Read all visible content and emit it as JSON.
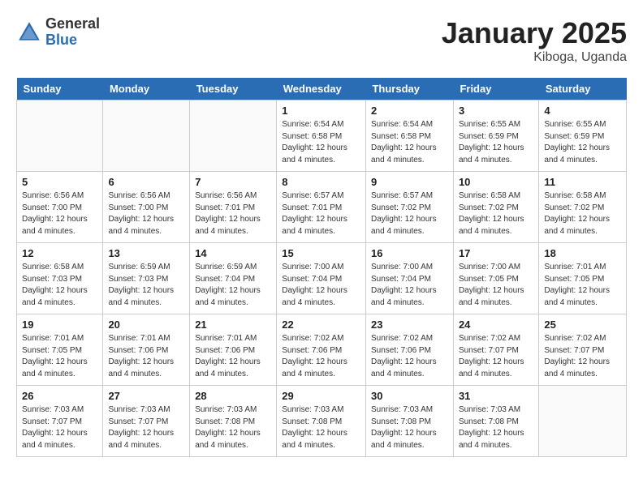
{
  "header": {
    "logo_general": "General",
    "logo_blue": "Blue",
    "month_title": "January 2025",
    "location": "Kiboga, Uganda"
  },
  "days_of_week": [
    "Sunday",
    "Monday",
    "Tuesday",
    "Wednesday",
    "Thursday",
    "Friday",
    "Saturday"
  ],
  "weeks": [
    [
      {
        "day": "",
        "info": ""
      },
      {
        "day": "",
        "info": ""
      },
      {
        "day": "",
        "info": ""
      },
      {
        "day": "1",
        "info": "Sunrise: 6:54 AM\nSunset: 6:58 PM\nDaylight: 12 hours\nand 4 minutes."
      },
      {
        "day": "2",
        "info": "Sunrise: 6:54 AM\nSunset: 6:58 PM\nDaylight: 12 hours\nand 4 minutes."
      },
      {
        "day": "3",
        "info": "Sunrise: 6:55 AM\nSunset: 6:59 PM\nDaylight: 12 hours\nand 4 minutes."
      },
      {
        "day": "4",
        "info": "Sunrise: 6:55 AM\nSunset: 6:59 PM\nDaylight: 12 hours\nand 4 minutes."
      }
    ],
    [
      {
        "day": "5",
        "info": "Sunrise: 6:56 AM\nSunset: 7:00 PM\nDaylight: 12 hours\nand 4 minutes."
      },
      {
        "day": "6",
        "info": "Sunrise: 6:56 AM\nSunset: 7:00 PM\nDaylight: 12 hours\nand 4 minutes."
      },
      {
        "day": "7",
        "info": "Sunrise: 6:56 AM\nSunset: 7:01 PM\nDaylight: 12 hours\nand 4 minutes."
      },
      {
        "day": "8",
        "info": "Sunrise: 6:57 AM\nSunset: 7:01 PM\nDaylight: 12 hours\nand 4 minutes."
      },
      {
        "day": "9",
        "info": "Sunrise: 6:57 AM\nSunset: 7:02 PM\nDaylight: 12 hours\nand 4 minutes."
      },
      {
        "day": "10",
        "info": "Sunrise: 6:58 AM\nSunset: 7:02 PM\nDaylight: 12 hours\nand 4 minutes."
      },
      {
        "day": "11",
        "info": "Sunrise: 6:58 AM\nSunset: 7:02 PM\nDaylight: 12 hours\nand 4 minutes."
      }
    ],
    [
      {
        "day": "12",
        "info": "Sunrise: 6:58 AM\nSunset: 7:03 PM\nDaylight: 12 hours\nand 4 minutes."
      },
      {
        "day": "13",
        "info": "Sunrise: 6:59 AM\nSunset: 7:03 PM\nDaylight: 12 hours\nand 4 minutes."
      },
      {
        "day": "14",
        "info": "Sunrise: 6:59 AM\nSunset: 7:04 PM\nDaylight: 12 hours\nand 4 minutes."
      },
      {
        "day": "15",
        "info": "Sunrise: 7:00 AM\nSunset: 7:04 PM\nDaylight: 12 hours\nand 4 minutes."
      },
      {
        "day": "16",
        "info": "Sunrise: 7:00 AM\nSunset: 7:04 PM\nDaylight: 12 hours\nand 4 minutes."
      },
      {
        "day": "17",
        "info": "Sunrise: 7:00 AM\nSunset: 7:05 PM\nDaylight: 12 hours\nand 4 minutes."
      },
      {
        "day": "18",
        "info": "Sunrise: 7:01 AM\nSunset: 7:05 PM\nDaylight: 12 hours\nand 4 minutes."
      }
    ],
    [
      {
        "day": "19",
        "info": "Sunrise: 7:01 AM\nSunset: 7:05 PM\nDaylight: 12 hours\nand 4 minutes."
      },
      {
        "day": "20",
        "info": "Sunrise: 7:01 AM\nSunset: 7:06 PM\nDaylight: 12 hours\nand 4 minutes."
      },
      {
        "day": "21",
        "info": "Sunrise: 7:01 AM\nSunset: 7:06 PM\nDaylight: 12 hours\nand 4 minutes."
      },
      {
        "day": "22",
        "info": "Sunrise: 7:02 AM\nSunset: 7:06 PM\nDaylight: 12 hours\nand 4 minutes."
      },
      {
        "day": "23",
        "info": "Sunrise: 7:02 AM\nSunset: 7:06 PM\nDaylight: 12 hours\nand 4 minutes."
      },
      {
        "day": "24",
        "info": "Sunrise: 7:02 AM\nSunset: 7:07 PM\nDaylight: 12 hours\nand 4 minutes."
      },
      {
        "day": "25",
        "info": "Sunrise: 7:02 AM\nSunset: 7:07 PM\nDaylight: 12 hours\nand 4 minutes."
      }
    ],
    [
      {
        "day": "26",
        "info": "Sunrise: 7:03 AM\nSunset: 7:07 PM\nDaylight: 12 hours\nand 4 minutes."
      },
      {
        "day": "27",
        "info": "Sunrise: 7:03 AM\nSunset: 7:07 PM\nDaylight: 12 hours\nand 4 minutes."
      },
      {
        "day": "28",
        "info": "Sunrise: 7:03 AM\nSunset: 7:08 PM\nDaylight: 12 hours\nand 4 minutes."
      },
      {
        "day": "29",
        "info": "Sunrise: 7:03 AM\nSunset: 7:08 PM\nDaylight: 12 hours\nand 4 minutes."
      },
      {
        "day": "30",
        "info": "Sunrise: 7:03 AM\nSunset: 7:08 PM\nDaylight: 12 hours\nand 4 minutes."
      },
      {
        "day": "31",
        "info": "Sunrise: 7:03 AM\nSunset: 7:08 PM\nDaylight: 12 hours\nand 4 minutes."
      },
      {
        "day": "",
        "info": ""
      }
    ]
  ]
}
